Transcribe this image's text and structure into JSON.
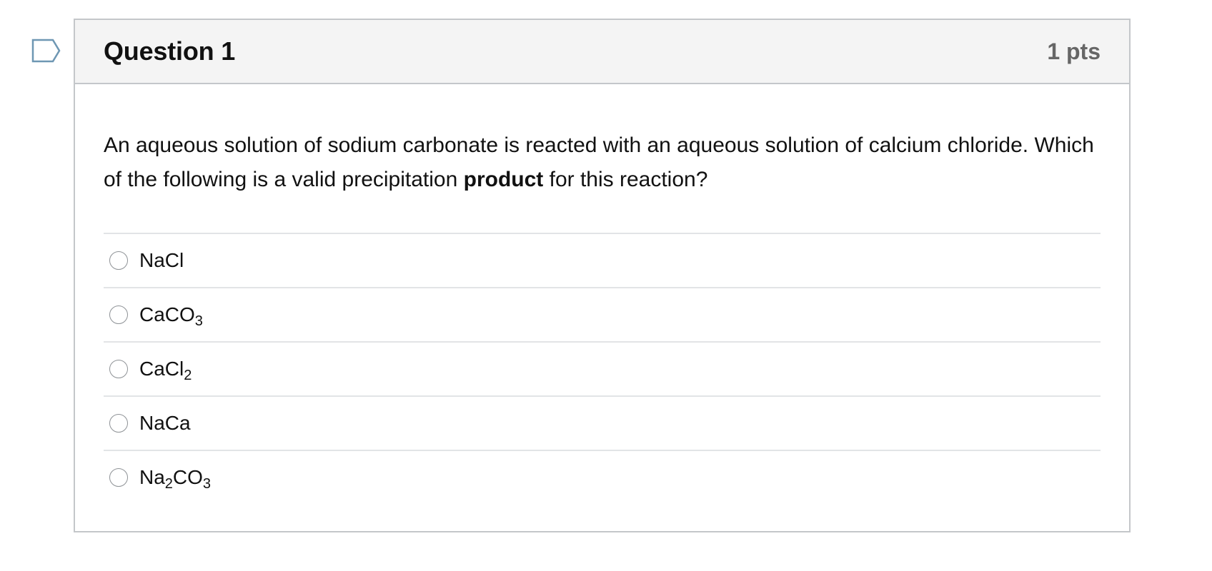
{
  "question": {
    "title": "Question 1",
    "points": "1 pts",
    "text_part1": "An aqueous solution of sodium carbonate is reacted with an aqueous solution of calcium chloride. Which of the following is a valid precipitation ",
    "text_bold": "product",
    "text_part2": " for this reaction?"
  },
  "answers": [
    {
      "main1": "NaCl",
      "sub1": "",
      "main2": "",
      "sub2": ""
    },
    {
      "main1": "CaCO",
      "sub1": "3",
      "main2": "",
      "sub2": ""
    },
    {
      "main1": "CaCl",
      "sub1": "2",
      "main2": "",
      "sub2": ""
    },
    {
      "main1": "NaCa",
      "sub1": "",
      "main2": "",
      "sub2": ""
    },
    {
      "main1": "Na",
      "sub1": "2",
      "main2": "CO",
      "sub2": "3"
    }
  ],
  "icons": {
    "flag": "bookmark-flag-icon",
    "radio": "radio-unselected-icon"
  },
  "colors": {
    "flag_outline": "#6e97b3",
    "header_bg": "#f4f4f4",
    "border": "#c4c7ca",
    "points_text": "#666666"
  }
}
